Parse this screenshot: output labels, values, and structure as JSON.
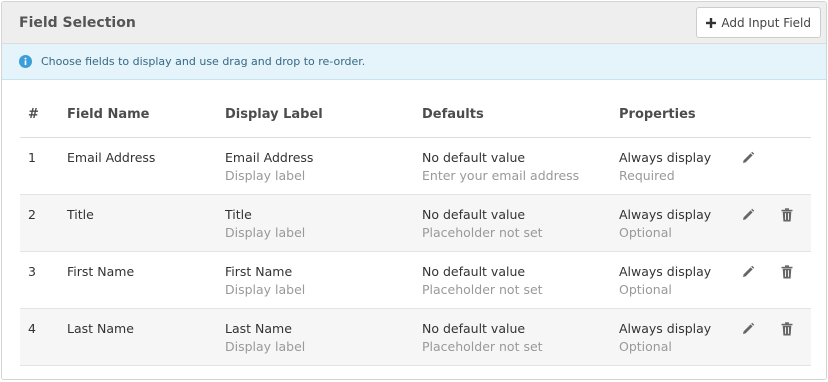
{
  "header": {
    "title": "Field Selection",
    "add_button_label": "Add Input Field"
  },
  "info": {
    "text": "Choose fields to display and use drag and drop to re-order."
  },
  "table": {
    "columns": [
      "#",
      "Field Name",
      "Display Label",
      "Defaults",
      "Properties"
    ],
    "rows": [
      {
        "num": "1",
        "field_name": "Email Address",
        "display_label": "Email Address",
        "display_label_sub": "Display label",
        "default": "No default value",
        "default_sub": "Enter your email address",
        "property": "Always display",
        "property_sub": "Required",
        "deletable": false
      },
      {
        "num": "2",
        "field_name": "Title",
        "display_label": "Title",
        "display_label_sub": "Display label",
        "default": "No default value",
        "default_sub": "Placeholder not set",
        "property": "Always display",
        "property_sub": "Optional",
        "deletable": true
      },
      {
        "num": "3",
        "field_name": "First Name",
        "display_label": "First Name",
        "display_label_sub": "Display label",
        "default": "No default value",
        "default_sub": "Placeholder not set",
        "property": "Always display",
        "property_sub": "Optional",
        "deletable": true
      },
      {
        "num": "4",
        "field_name": "Last Name",
        "display_label": "Last Name",
        "display_label_sub": "Display label",
        "default": "No default value",
        "default_sub": "Placeholder not set",
        "property": "Always display",
        "property_sub": "Optional",
        "deletable": true
      }
    ]
  },
  "icons": {
    "add": "plus-icon",
    "info": "info-icon",
    "edit": "pencil-icon",
    "delete": "trash-icon"
  },
  "colors": {
    "header_bg": "#eeeeee",
    "info_bg": "#e5f3fa",
    "info_icon": "#3a9fd8",
    "stripe_bg": "#f6f6f6",
    "muted_text": "#999999"
  }
}
